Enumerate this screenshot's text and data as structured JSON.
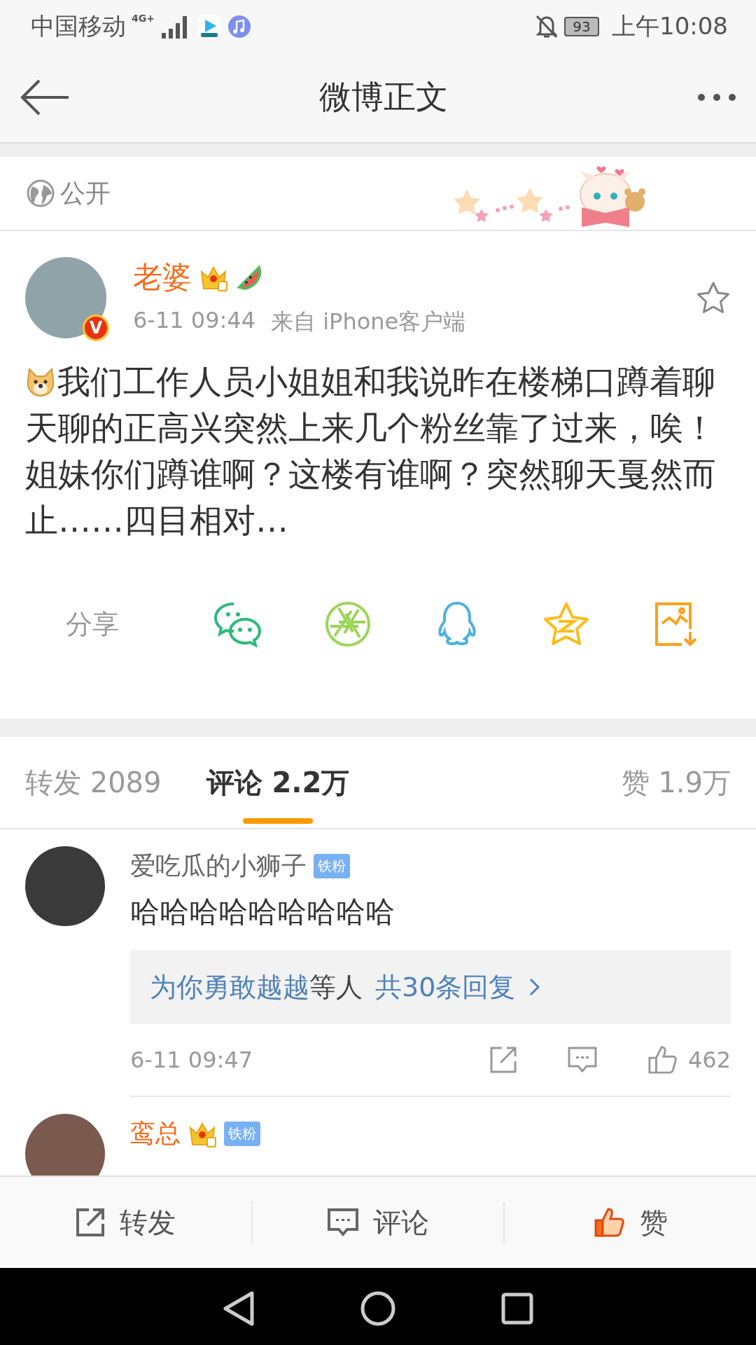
{
  "status_bar": {
    "carrier": "中国移动",
    "network": "4G+",
    "battery": "93",
    "time": "上午10:08"
  },
  "header": {
    "title": "微博正文"
  },
  "visibility": {
    "label": "公开"
  },
  "post": {
    "author": "老婆",
    "verified_badge": "V",
    "time": "6-11 09:44",
    "source": "来自 iPhone客户端",
    "favorited": false,
    "text": "我们工作人员小姐姐和我说昨在楼梯口蹲着聊天聊的正高兴突然上来几个粉丝靠了过来，唉！姐妹你们蹲谁啊？这楼有谁啊？突然聊天戛然而止……四目相对…"
  },
  "share": {
    "label": "分享",
    "targets": [
      {
        "kind": "wechat",
        "color": "#2dba77"
      },
      {
        "kind": "moments",
        "color": "#9ed55a"
      },
      {
        "kind": "qq",
        "color": "#4fb0e0"
      },
      {
        "kind": "qzone",
        "color": "#fbbd18"
      },
      {
        "kind": "save",
        "color": "#f9a21b"
      }
    ]
  },
  "tabs": [
    {
      "label": "转发 2089",
      "selected": false
    },
    {
      "label": "评论 2.2万",
      "selected": true
    },
    {
      "label": "赞 1.9万",
      "selected": false
    }
  ],
  "comments": [
    {
      "name": "爱吃瓜的小狮子",
      "vip": false,
      "badge": "铁粉",
      "text": "哈哈哈哈哈哈哈哈哈",
      "replies": {
        "users": "为你勇敢越越",
        "suffix": "等人",
        "count": "共30条回复"
      },
      "time": "6-11 09:47",
      "likes": "462"
    },
    {
      "name": "鸾总",
      "vip": true,
      "badge": "铁粉"
    }
  ],
  "action_bar": [
    {
      "kind": "repost",
      "label": "转发",
      "active": false
    },
    {
      "kind": "comment",
      "label": "评论",
      "active": false
    },
    {
      "kind": "like",
      "label": "赞",
      "active": true
    }
  ]
}
